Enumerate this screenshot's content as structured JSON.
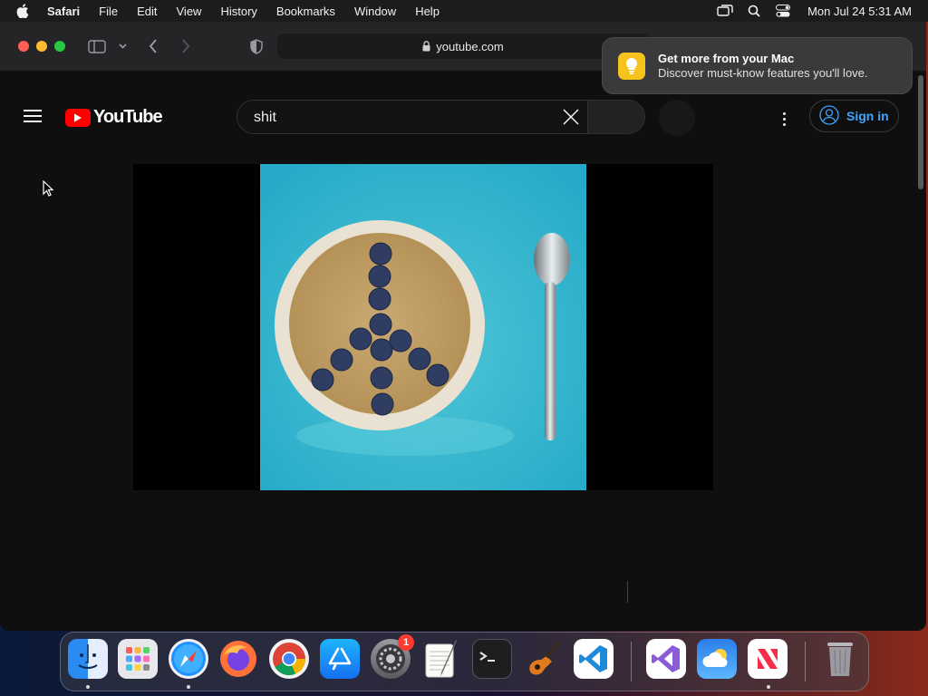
{
  "menubar": {
    "app": "Safari",
    "items": [
      "File",
      "Edit",
      "View",
      "History",
      "Bookmarks",
      "Window",
      "Help"
    ],
    "clock": "Mon Jul 24  5:31 AM"
  },
  "browser": {
    "url": "youtube.com"
  },
  "notification": {
    "title": "Get more from your Mac",
    "body": "Discover must-know features you'll love."
  },
  "youtube": {
    "logo_text": "YouTube",
    "search_value": "shit",
    "signin_label": "Sign in"
  },
  "dock": {
    "apps": [
      "Finder",
      "Launchpad",
      "Safari",
      "Firefox",
      "Google Chrome",
      "App Store",
      "System Settings",
      "TextEdit",
      "Terminal",
      "GarageBand",
      "Visual Studio Code",
      "Visual Studio",
      "Weather",
      "News",
      "Trash"
    ],
    "system_settings_badge": "1"
  },
  "colors": {
    "youtube_red": "#ff0000",
    "signin_blue": "#3ea6ff",
    "video_bg": "#2fb4cf"
  }
}
